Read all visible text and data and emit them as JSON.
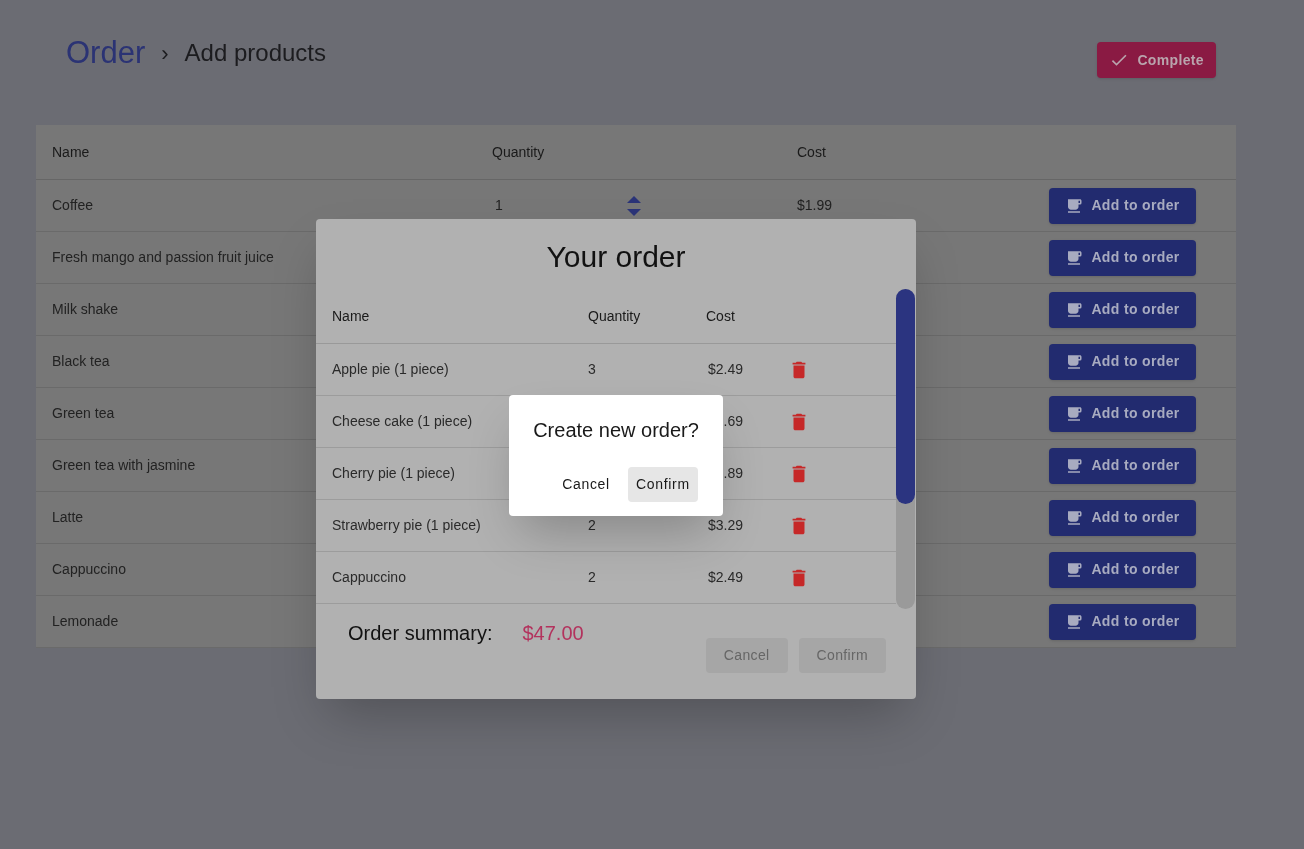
{
  "breadcrumb": {
    "root": "Order",
    "separator": "›",
    "current": "Add products"
  },
  "complete_button": {
    "label": "Complete"
  },
  "products": {
    "columns": [
      "Name",
      "Quantity",
      "Cost"
    ],
    "rows": [
      {
        "name": "Coffee",
        "quantity": "1",
        "cost": "$1.99",
        "action": "Add to order"
      },
      {
        "name": "Fresh mango and passion fruit juice",
        "action": "Add to order"
      },
      {
        "name": "Milk shake",
        "action": "Add to order"
      },
      {
        "name": "Black tea",
        "action": "Add to order"
      },
      {
        "name": "Green tea",
        "action": "Add to order"
      },
      {
        "name": "Green tea with jasmine",
        "action": "Add to order"
      },
      {
        "name": "Latte",
        "action": "Add to order"
      },
      {
        "name": "Cappuccino",
        "action": "Add to order"
      },
      {
        "name": "Lemonade",
        "action": "Add to order"
      }
    ]
  },
  "order_dialog": {
    "title": "Your order",
    "columns": [
      "Name",
      "Quantity",
      "Cost"
    ],
    "items": [
      {
        "name": "Apple pie (1 piece)",
        "quantity": "3",
        "cost": "$2.49"
      },
      {
        "name": "Cheese cake (1 piece)",
        "cost": ".69"
      },
      {
        "name": "Cherry pie (1 piece)",
        "cost": ".89"
      },
      {
        "name": "Strawberry pie (1 piece)",
        "quantity": "2",
        "cost": "$3.29"
      },
      {
        "name": "Cappuccino",
        "quantity": "2",
        "cost": "$2.49"
      }
    ],
    "summary_label": "Order summary:",
    "total": "$47.00",
    "buttons": [
      {
        "label": "Cancel",
        "disabled": true
      },
      {
        "label": "Confirm",
        "disabled": true
      }
    ]
  },
  "confirm_dialog": {
    "title": "Create new order?",
    "buttons": [
      {
        "label": "Cancel",
        "focused": false
      },
      {
        "label": "Confirm",
        "focused": true
      }
    ]
  }
}
